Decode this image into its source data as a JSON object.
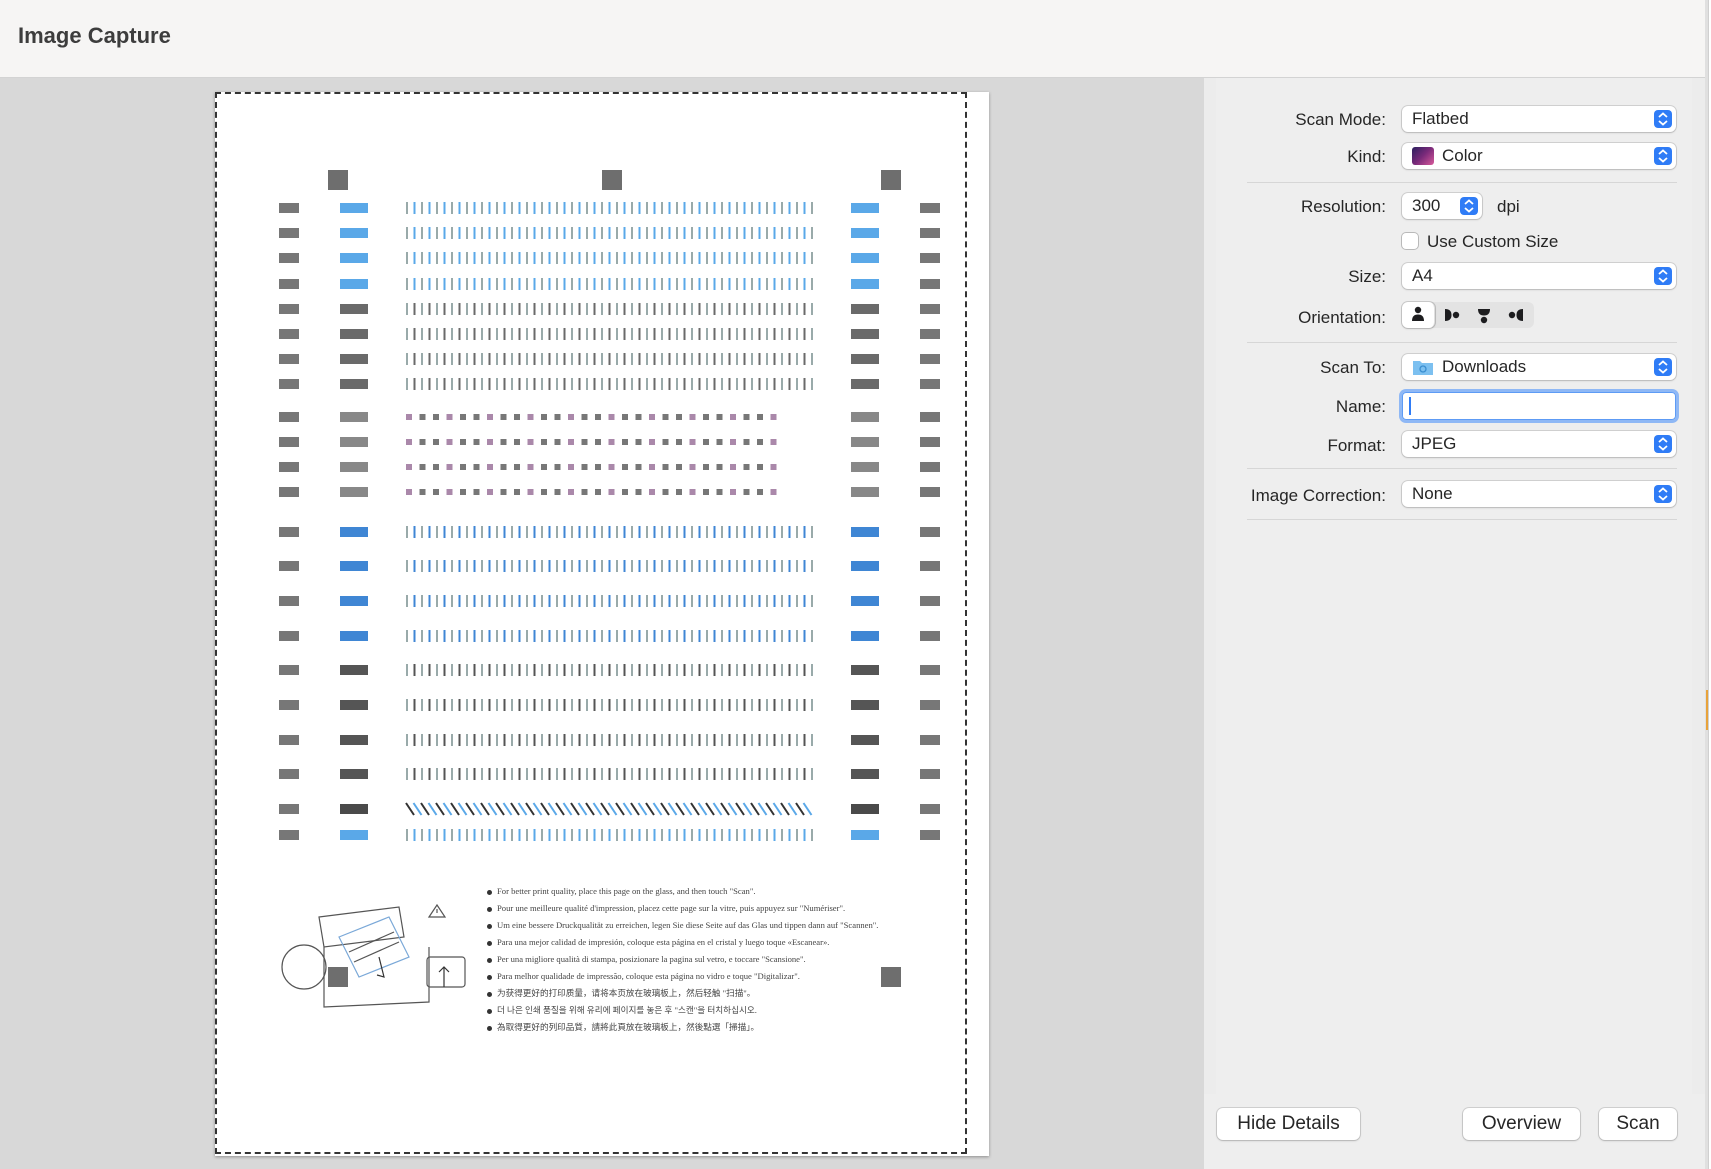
{
  "window": {
    "title": "Image Capture"
  },
  "instructions": [
    "For better print quality, place this page on the glass, and then touch \"Scan\".",
    "Pour une meilleure qualité d'impression, placez cette page sur la vitre, puis appuyez sur \"Numériser\".",
    "Um eine bessere Druckqualität zu erreichen, legen Sie diese Seite auf das Glas und tippen dann auf \"Scannen\".",
    "Para una mejor calidad de impresión, coloque esta página en el cristal y luego toque «Escanear».",
    "Per una migliore qualità di stampa, posizionare la pagina sul vetro, e toccare \"Scansione\".",
    "Para melhor qualidade de impressão, coloque esta página no vidro e toque \"Digitalizar\".",
    "为获得更好的打印质量，请将本页放在玻璃板上，然后轻触 \"扫描\"。",
    "더 나은 인쇄 품질을 위해 유리에 페이지를 놓은 후 \"스캔\"을 터치하십시오.",
    "為取得更好的列印品質，請將此頁放在玻璃板上，然後點選「掃描」。"
  ],
  "settings": {
    "scan_mode": {
      "label": "Scan Mode:",
      "value": "Flatbed"
    },
    "kind": {
      "label": "Kind:",
      "value": "Color"
    },
    "resolution": {
      "label": "Resolution:",
      "value": "300",
      "unit": "dpi"
    },
    "custom_size": {
      "label": "Use Custom Size",
      "checked": false
    },
    "size": {
      "label": "Size:",
      "value": "A4"
    },
    "orientation": {
      "label": "Orientation:",
      "selected_index": 0
    },
    "scan_to": {
      "label": "Scan To:",
      "value": "Downloads"
    },
    "name": {
      "label": "Name:",
      "value": ""
    },
    "format": {
      "label": "Format:",
      "value": "JPEG"
    },
    "image_correction": {
      "label": "Image Correction:",
      "value": "None"
    }
  },
  "buttons": {
    "hide_details": "Hide Details",
    "overview": "Overview",
    "scan": "Scan"
  },
  "colors": {
    "accent": "#2f7cf6",
    "pattern_blue": "#5aa8e8",
    "pattern_gray": "#6a6a6a"
  }
}
